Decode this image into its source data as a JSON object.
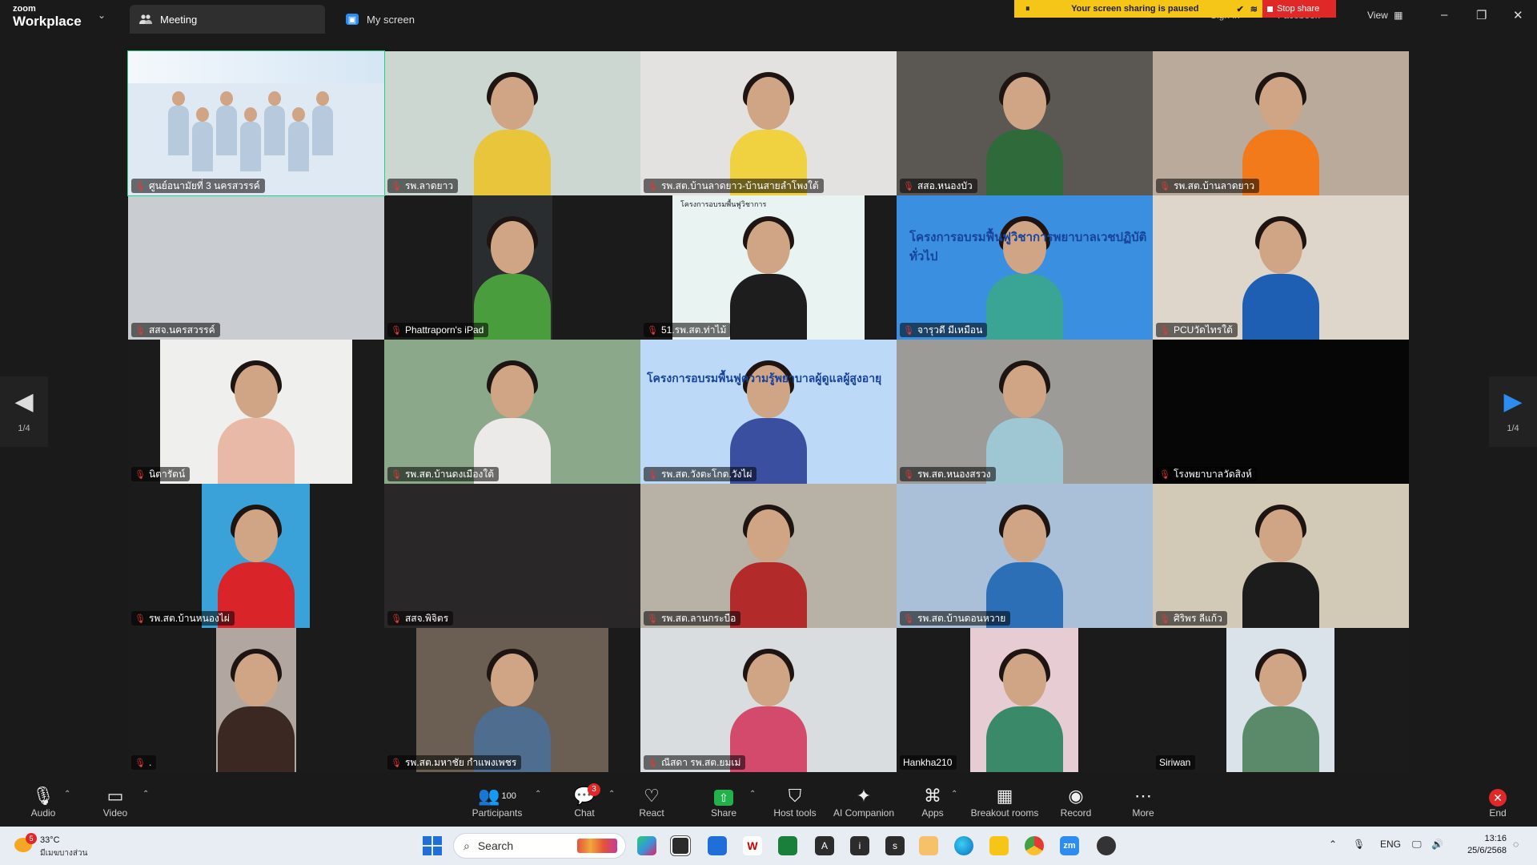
{
  "app": {
    "logo_top": "zoom",
    "logo_bottom": "Workplace"
  },
  "tabs": [
    {
      "label": "Meeting"
    },
    {
      "label": "My screen"
    }
  ],
  "share_banner": {
    "message": "Your screen sharing is paused",
    "stop_label": "Stop share"
  },
  "header": {
    "signin_partial": "Sign in",
    "account_partial": "Facebook",
    "view_label": "View"
  },
  "gallery": {
    "page_left": "1/4",
    "page_right": "1/4"
  },
  "participants": [
    {
      "name": "ศูนย์อนามัยที่ 3 นครสวรรค์",
      "bg": "#dfe9f3",
      "shirt": "#b6c9dd"
    },
    {
      "name": "รพ.ลาดยาว",
      "bg": "#cdd7d2",
      "shirt": "#e8c53a"
    },
    {
      "name": "รพ.สต.บ้านลาดยาว-บ้านสายลำโพงใต้",
      "bg": "#e4e2e0",
      "shirt": "#f0d13f"
    },
    {
      "name": "สสอ.หนองบัว",
      "bg": "#5b5853",
      "shirt": "#2f6b3a"
    },
    {
      "name": "รพ.สต.บ้านลาดยาว",
      "bg": "#b9aa9c",
      "shirt": "#f27a1a"
    },
    {
      "name": "สสจ.นครสวรรค์",
      "bg": "#c9ccd0",
      "shirt": ""
    },
    {
      "name": "Phattraporn's iPad",
      "bg": "#2a2d2f",
      "shirt": "#4a9d3c"
    },
    {
      "name": "51.รพ.สต.ท่าไม้",
      "bg": "#e9f3f1",
      "shirt": "#1d1d1d"
    },
    {
      "name": "จารุวดี มีเหมือน",
      "bg": "#3a8fe0",
      "shirt": "#3aa595"
    },
    {
      "name": "PCUวัดไทรใต้",
      "bg": "#ded6cb",
      "shirt": "#1f5fb3"
    },
    {
      "name": "นิตารัตน์",
      "bg": "#efefee",
      "shirt": "#e9b9a8"
    },
    {
      "name": "รพ.สต.บ้านดงเมืองใต้",
      "bg": "#8ba88a",
      "shirt": "#eceae8"
    },
    {
      "name": "รพ.สต.วังตะโกต.วังไผ่",
      "bg": "#bcdaf7",
      "shirt": "#3b4fa0"
    },
    {
      "name": "รพ.สต.หนองสรวง",
      "bg": "#9c9b97",
      "shirt": "#9fc7d3"
    },
    {
      "name": "โรงพยาบาลวัดสิงห์",
      "bg": "#060606",
      "shirt": ""
    },
    {
      "name": "รพ.สต.บ้านหนองไผ่",
      "bg": "#3aa2d9",
      "shirt": "#d9252a"
    },
    {
      "name": "สสจ.พิจิตร",
      "bg": "#2a2729",
      "shirt": ""
    },
    {
      "name": "รพ.สต.ลานกระบือ",
      "bg": "#b8b1a6",
      "shirt": "#b22a2a"
    },
    {
      "name": "รพ.สต.บ้านดอนหวาย",
      "bg": "#a9c0d8",
      "shirt": "#2d6fb7"
    },
    {
      "name": "ศิริพร ลีแก้ว",
      "bg": "#d3c9b7",
      "shirt": "#1c1c1c"
    },
    {
      "name": ".",
      "bg": "#b1a7a0",
      "shirt": "#3b2822"
    },
    {
      "name": "รพ.สต.มหาชัย กำแพงเพชร",
      "bg": "#6b5e52",
      "shirt": "#4f6d8e"
    },
    {
      "name": "ณีสดา รพ.สต.ยมเม่",
      "bg": "#d9dde0",
      "shirt": "#d34a6d"
    },
    {
      "name": "Hankha210",
      "bg": "#e7cdd3",
      "shirt": "#3a8a6a"
    },
    {
      "name": "Siriwan",
      "bg": "#dbe3ea",
      "shirt": "#5a8a6a"
    }
  ],
  "slides": {
    "s8": "โครงการอบรมพื้นฟูวิชาการ",
    "s9": "โครงการอบรมฟื้นฟูวิชาการพยาบาลเวชปฏิบัติทั่วไป",
    "s13": "โครงการอบรมพื้นฟูความรู้พยาบาลผู้ดูแลผู้สูงอายุ"
  },
  "toolbar": {
    "audio": "Audio",
    "video": "Video",
    "participants": "Participants",
    "participants_count": "100",
    "chat": "Chat",
    "chat_badge": "3",
    "react": "React",
    "share": "Share",
    "host_tools": "Host tools",
    "ai_companion": "AI Companion",
    "apps": "Apps",
    "breakout": "Breakout rooms",
    "record": "Record",
    "more": "More",
    "end": "End"
  },
  "taskbar": {
    "weather_temp": "33°C",
    "weather_cond": "มีเมฆบางส่วน",
    "weather_badge": "5",
    "search_placeholder": "Search",
    "lang": "ENG",
    "time": "13:16",
    "date": "25/6/2568"
  },
  "colors": {
    "accent_green": "#23d18b",
    "stop_red": "#e02828",
    "banner_yellow": "#f5c518"
  }
}
